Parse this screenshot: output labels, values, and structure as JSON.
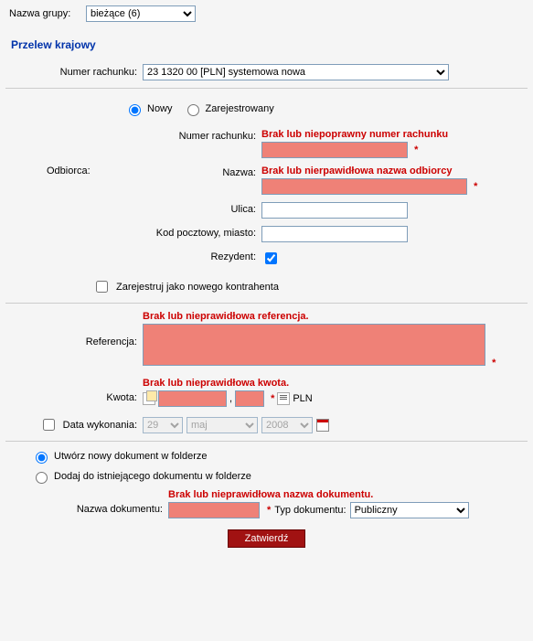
{
  "group": {
    "label": "Nazwa grupy:",
    "value": "bieżące (6)"
  },
  "section_title": "Przelew krajowy",
  "account": {
    "label": "Numer rachunku:",
    "value": "23 1320                                               00 [PLN]   systemowa nowa"
  },
  "radio_new": "Nowy",
  "radio_registered": "Zarejestrowany",
  "recipient": {
    "section_label": "Odbiorca:",
    "account_label": "Numer rachunku:",
    "account_error": "Brak lub niepoprawny numer rachunku",
    "name_label": "Nazwa:",
    "name_error": "Brak lub nierpawidłowa nazwa odbiorcy",
    "street_label": "Ulica:",
    "postal_label": "Kod pocztowy, miasto:",
    "resident_label": "Rezydent:",
    "register_label": "Zarejestruj jako nowego kontrahenta"
  },
  "reference": {
    "label": "Referencja:",
    "error": "Brak lub nieprawidłowa referencja."
  },
  "amount": {
    "label": "Kwota:",
    "error": "Brak lub nieprawidłowa kwota.",
    "currency": "PLN",
    "sep": ","
  },
  "exec_date": {
    "label": "Data wykonania:",
    "day": "29",
    "month": "maj",
    "year": "2008"
  },
  "doc_option_new": "Utwórz nowy dokument w folderze",
  "doc_option_add": "Dodaj do istniejącego dokumentu w folderze",
  "doc_name": {
    "label": "Nazwa dokumentu:",
    "error": "Brak lub nieprawidłowa nazwa dokumentu."
  },
  "doc_type": {
    "label": "Typ dokumentu:",
    "value": "Publiczny"
  },
  "confirm": "Zatwierdź",
  "asterisk": "*"
}
